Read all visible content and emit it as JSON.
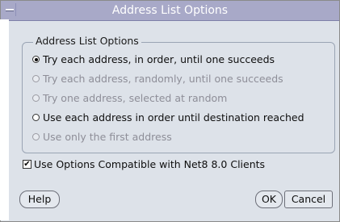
{
  "window": {
    "title": "Address List Options"
  },
  "group": {
    "legend": "Address List Options",
    "options": [
      {
        "label": "Try each address, in order, until one succeeds",
        "selected": true,
        "enabled": true
      },
      {
        "label": "Try each address, randomly, until one succeeds",
        "selected": false,
        "enabled": false
      },
      {
        "label": "Try one address, selected at random",
        "selected": false,
        "enabled": false
      },
      {
        "label": "Use each address in order until destination reached",
        "selected": false,
        "enabled": true
      },
      {
        "label": "Use only the first address",
        "selected": false,
        "enabled": false
      }
    ]
  },
  "compat_checkbox": {
    "label": "Use Options Compatible with Net8 8.0 Clients",
    "checked": true
  },
  "buttons": {
    "help": "Help",
    "ok": "OK",
    "cancel": "Cancel"
  },
  "colors": {
    "titlebar": "#a8a9c8",
    "dialog_bg": "#dde2e9",
    "disabled_text": "#8e8e98"
  }
}
